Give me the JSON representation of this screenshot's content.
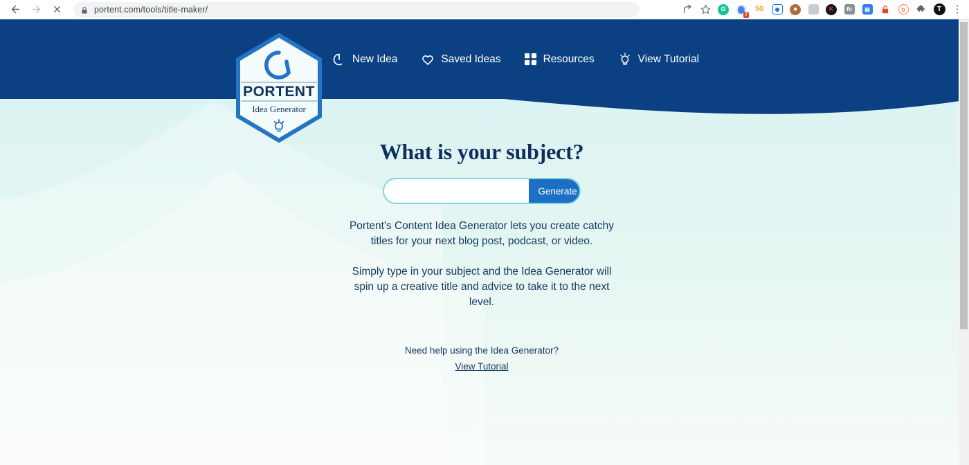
{
  "browser": {
    "back_label": "Back",
    "forward_label": "Forward",
    "stop_label": "Stop",
    "url": "portent.com/tools/title-maker/",
    "lock_icon": "lock-icon",
    "share_icon": "share-icon",
    "bookmark_icon": "star-icon",
    "menu_icon": "kebab-menu-icon",
    "extensions": [
      {
        "name": "grammarly-extension-icon",
        "glyph": "G",
        "bg": "#15c39a",
        "shape": "circle",
        "badge": null
      },
      {
        "name": "snowflake-extension-icon",
        "glyph": "✳",
        "bg": "#3b82f6",
        "shape": "plain",
        "badge": "7"
      },
      {
        "name": "seo-extension-icon",
        "glyph": "50",
        "bg": "#f5a623",
        "shape": "plain",
        "badge": null
      },
      {
        "name": "screen-recorder-extension-icon",
        "glyph": "▣",
        "bg": "#1a73e8",
        "shape": "plain",
        "badge": null
      },
      {
        "name": "cookie-extension-icon",
        "glyph": "🍪",
        "bg": "#8b5a2b",
        "shape": "circle",
        "badge": null
      },
      {
        "name": "image-extension-icon",
        "glyph": "▨",
        "bg": "#9aa0a6",
        "shape": "square",
        "badge": null
      },
      {
        "name": "keywords-everywhere-extension-icon",
        "glyph": "K",
        "bg": "#1a1a1a",
        "shape": "circle",
        "badge": null
      },
      {
        "name": "fb-pixel-extension-icon",
        "glyph": "fb",
        "bg": "#8a8f94",
        "shape": "square",
        "badge": null
      },
      {
        "name": "clipboard-extension-icon",
        "glyph": "▤",
        "bg": "#2f80ed",
        "shape": "square",
        "badge": null
      },
      {
        "name": "lastpass-extension-icon",
        "glyph": "▮",
        "bg": "#e8442b",
        "shape": "plain",
        "badge": null
      },
      {
        "name": "hubspot-extension-icon",
        "glyph": "ⓑ",
        "bg": "#ff7a59",
        "shape": "plain",
        "badge": null
      },
      {
        "name": "extensions-puzzle-icon",
        "glyph": "✦",
        "bg": "#5f6368",
        "shape": "plain",
        "badge": null
      },
      {
        "name": "github-profile-icon",
        "glyph": "T",
        "bg": "#111111",
        "shape": "circle",
        "badge": null
      }
    ]
  },
  "site": {
    "brand": {
      "name": "PORTENT",
      "tagline": "Idea Generator",
      "mark_icon": "portent-swirl-icon",
      "bulb_icon": "lightbulb-icon"
    },
    "header_color": "#0b4182",
    "nav": [
      {
        "label": "New Idea",
        "icon": "new-idea-circle-icon"
      },
      {
        "label": "Saved Ideas",
        "icon": "heart-icon"
      },
      {
        "label": "Resources",
        "icon": "grid-squares-icon"
      },
      {
        "label": "View Tutorial",
        "icon": "lightbulb-idea-icon"
      }
    ]
  },
  "main": {
    "headline": "What is your subject?",
    "search": {
      "value": "",
      "placeholder": "",
      "button_label": "Generate Idea",
      "button_color": "#1b6fc4",
      "border_color": "#7fd6e0"
    },
    "paragraph_1": "Portent's Content Idea Generator lets you create catchy titles for your next blog post, podcast, or video.",
    "paragraph_2": "Simply type in your subject and the Idea Generator will spin up a creative title and advice to take it to the next level.",
    "help_text": "Need help using the Idea Generator?",
    "help_link": "View Tutorial"
  },
  "scrollbar": {
    "up_arrow": "▲",
    "down_arrow": "▼"
  }
}
